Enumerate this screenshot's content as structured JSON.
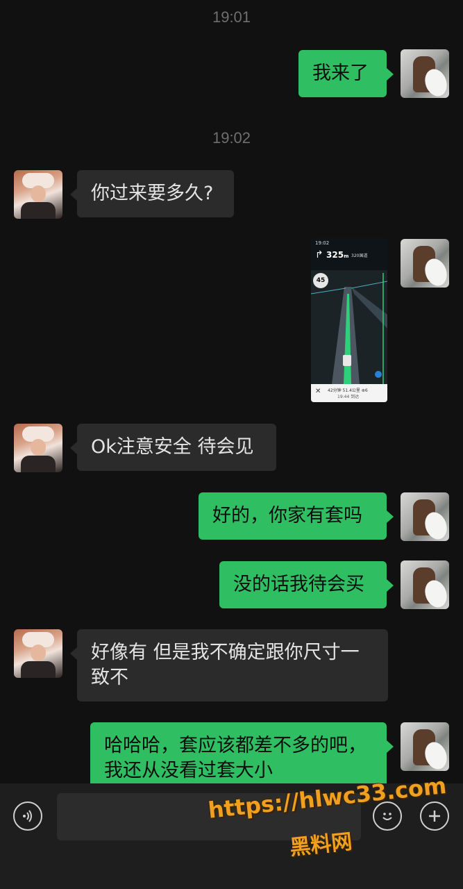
{
  "timestamps": [
    "19:01",
    "19:02"
  ],
  "messages": [
    {
      "side": "right",
      "text": "我来了"
    },
    {
      "side": "left",
      "text": "你过来要多久?"
    },
    {
      "side": "right",
      "type": "image"
    },
    {
      "side": "left",
      "text": "Ok注意安全 待会见"
    },
    {
      "side": "right",
      "text": "好的，你家有套吗"
    },
    {
      "side": "right",
      "text": "没的话我待会买"
    },
    {
      "side": "left",
      "text": "好像有 但是我不确定跟你尺寸一致不"
    },
    {
      "side": "right",
      "text": "哈哈哈，套应该都差不多的吧，我还从没看过套大小"
    }
  ],
  "nav_screenshot": {
    "time": "19:02",
    "distance": "325",
    "distance_unit": "m",
    "road": "320国道",
    "speed_limit": "45",
    "eta_summary": "42分钟 51.4公里 ⊛6",
    "arrival": "19:44 到达"
  },
  "input_bar": {
    "placeholder": "",
    "voice_icon": "voice-icon",
    "emoji_icon": "emoji-icon",
    "plus_icon": "plus-icon"
  },
  "watermark": {
    "url": "https://hlwc33.com",
    "name": "黑料网"
  },
  "colors": {
    "background": "#111111",
    "sent_bubble": "#2fbf62",
    "received_bubble": "#2b2b2b"
  }
}
